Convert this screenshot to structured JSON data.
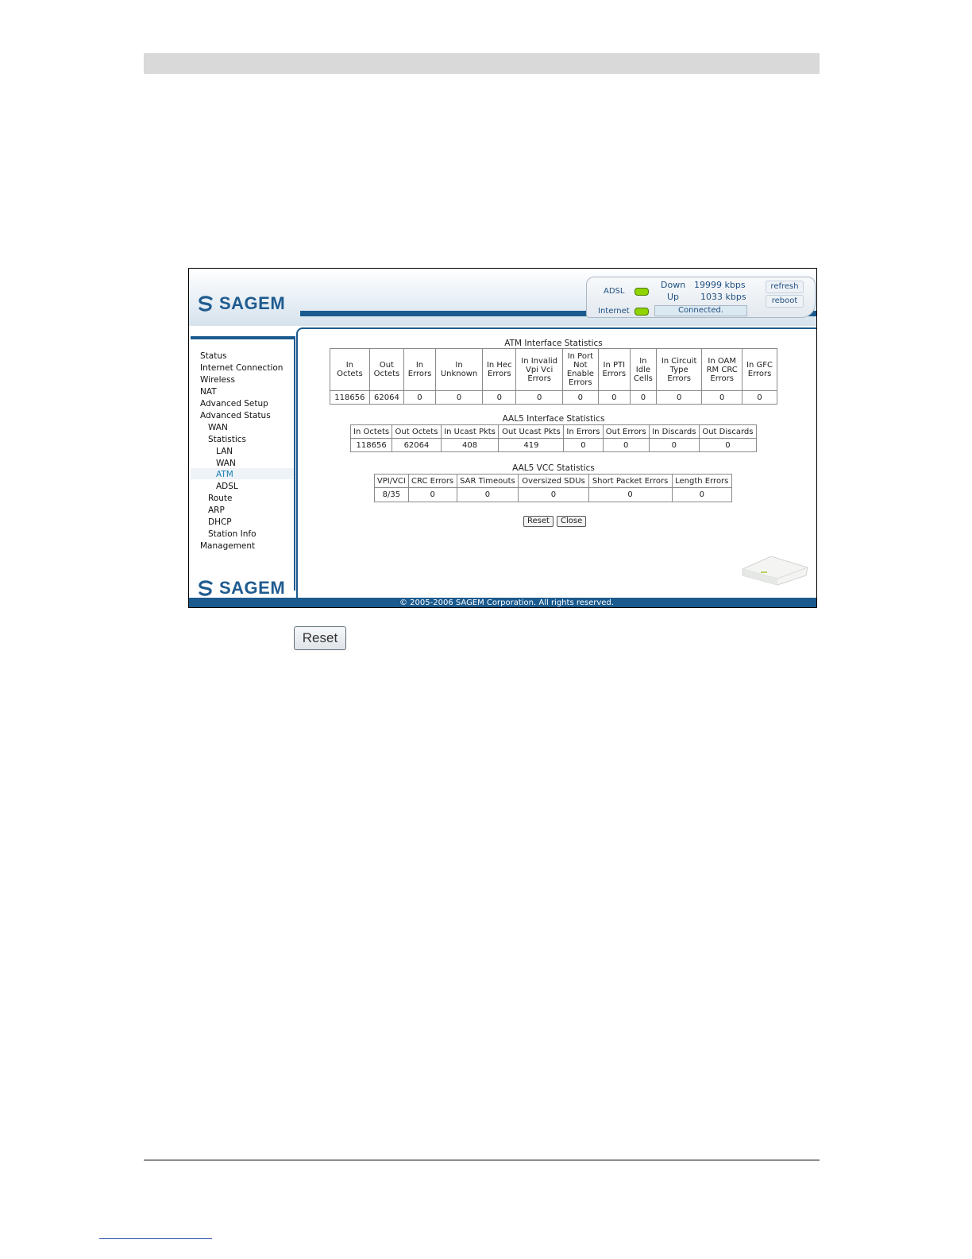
{
  "header": {
    "brand": "SAGEM",
    "status": {
      "adsl_label": "ADSL",
      "internet_label": "Internet",
      "down_label": "Down",
      "down_rate": "19999 kbps",
      "up_label": "Up",
      "up_rate": "1033 kbps",
      "connection_status": "Connected.",
      "led_color": "#8fd400"
    },
    "buttons": {
      "refresh": "refresh",
      "reboot": "reboot"
    }
  },
  "sidebar": {
    "items": [
      {
        "label": "Status"
      },
      {
        "label": "Internet Connection"
      },
      {
        "label": "Wireless"
      },
      {
        "label": "NAT"
      },
      {
        "label": "Advanced Setup"
      },
      {
        "label": "Advanced Status"
      },
      {
        "label": "WAN"
      },
      {
        "label": "Statistics"
      },
      {
        "label": "LAN"
      },
      {
        "label": "WAN"
      },
      {
        "label": "ATM"
      },
      {
        "label": "ADSL"
      },
      {
        "label": "Route"
      },
      {
        "label": "ARP"
      },
      {
        "label": "DHCP"
      },
      {
        "label": "Station Info"
      },
      {
        "label": "Management"
      }
    ],
    "active": "ATM",
    "footer_brand": "SAGEM"
  },
  "atm_stats": {
    "title": "ATM Interface Statistics",
    "headers": [
      [
        "In",
        "Octets"
      ],
      [
        "Out",
        "Octets"
      ],
      [
        "In",
        "Errors"
      ],
      [
        "In",
        "Unknown"
      ],
      [
        "In Hec",
        "Errors"
      ],
      [
        "In Invalid",
        "Vpi Vci",
        "Errors"
      ],
      [
        "In Port",
        "Not",
        "Enable",
        "Errors"
      ],
      [
        "In PTI",
        "Errors"
      ],
      [
        "In",
        "Idle",
        "Cells"
      ],
      [
        "In Circuit",
        "Type",
        "Errors"
      ],
      [
        "In OAM",
        "RM CRC",
        "Errors"
      ],
      [
        "In GFC",
        "Errors"
      ]
    ],
    "values": [
      "118656",
      "62064",
      "0",
      "0",
      "0",
      "0",
      "0",
      "0",
      "0",
      "0",
      "0",
      "0"
    ]
  },
  "aal5_stats": {
    "title": "AAL5 Interface Statistics",
    "headers": [
      "In Octets",
      "Out Octets",
      "In Ucast Pkts",
      "Out Ucast Pkts",
      "In Errors",
      "Out Errors",
      "In Discards",
      "Out Discards"
    ],
    "values": [
      "118656",
      "62064",
      "408",
      "419",
      "0",
      "0",
      "0",
      "0"
    ]
  },
  "vcc_stats": {
    "title": "AAL5 VCC Statistics",
    "headers": [
      "VPI/VCI",
      "CRC Errors",
      "SAR Timeouts",
      "Oversized SDUs",
      "Short Packet Errors",
      "Length Errors"
    ],
    "values": [
      "8/35",
      "0",
      "0",
      "0",
      "0",
      "0"
    ]
  },
  "actions": {
    "reset": "Reset",
    "close": "Close"
  },
  "footer": {
    "copyright": "© 2005-2006 SAGEM Corporation. All rights reserved."
  },
  "callout": {
    "reset_label": "Reset"
  },
  "colors": {
    "brand_blue": "#1a5a8e",
    "accent": "#1a7fb3"
  }
}
